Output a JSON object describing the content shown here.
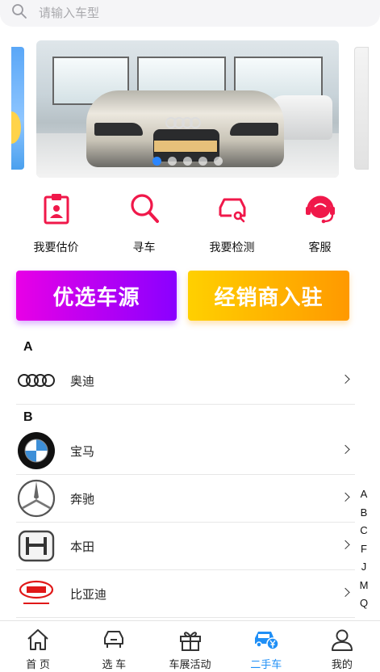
{
  "search": {
    "placeholder": "请输入车型"
  },
  "banner": {
    "slide_count": 5,
    "active_slide": 1,
    "plate_text": ""
  },
  "quick_menu": [
    {
      "label": "我要估价",
      "icon": "clipboard-user-icon"
    },
    {
      "label": "寻车",
      "icon": "search-icon"
    },
    {
      "label": "我要检测",
      "icon": "car-inspect-icon"
    },
    {
      "label": "客服",
      "icon": "headset-icon"
    }
  ],
  "promo": {
    "left_label": "优选车源",
    "right_label": "经销商入驻"
  },
  "brands": {
    "groups": [
      {
        "letter": "A",
        "items": [
          {
            "name": "奥迪",
            "logo": "audi-logo"
          }
        ]
      },
      {
        "letter": "B",
        "items": [
          {
            "name": "宝马",
            "logo": "bmw-logo"
          },
          {
            "name": "奔驰",
            "logo": "mercedes-logo"
          },
          {
            "name": "本田",
            "logo": "honda-logo"
          },
          {
            "name": "比亚迪",
            "logo": "byd-logo"
          }
        ]
      }
    ]
  },
  "index_letters": [
    "A",
    "B",
    "C",
    "F",
    "J",
    "M",
    "Q"
  ],
  "tabbar": [
    {
      "label": "首 页",
      "icon": "home-icon"
    },
    {
      "label": "选 车",
      "icon": "car-select-icon"
    },
    {
      "label": "车展活动",
      "icon": "gift-icon"
    },
    {
      "label": "二手车",
      "icon": "used-car-icon",
      "active": true
    },
    {
      "label": "我的",
      "icon": "user-icon"
    }
  ],
  "colors": {
    "accent_red": "#f0184a",
    "active_blue": "#1f8ff6"
  }
}
